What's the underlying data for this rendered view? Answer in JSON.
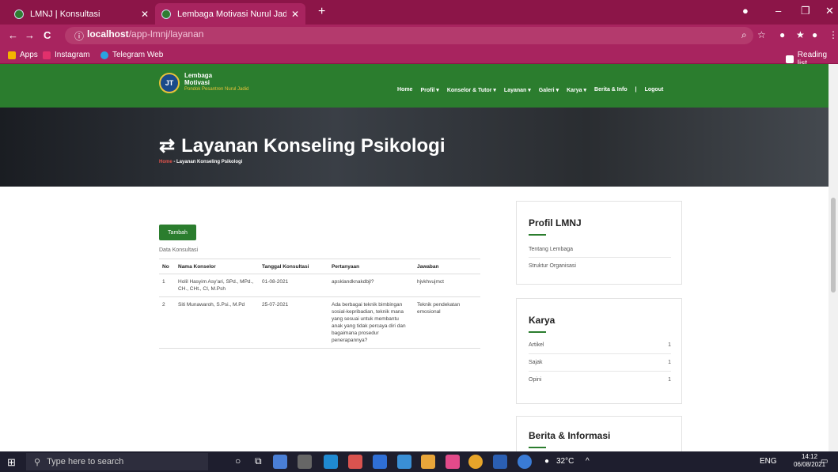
{
  "browser": {
    "tabs": [
      {
        "title": "LMNJ | Konsultasi",
        "close": "✕"
      },
      {
        "title": "Lembaga Motivasi Nurul Jadid - I",
        "close": "✕"
      }
    ],
    "new_tab": "+",
    "window_controls": {
      "minimize": "–",
      "maximize": "❐",
      "close": "✕"
    },
    "nav": {
      "back": "←",
      "forward": "→",
      "reload": "C"
    },
    "url_host": "localhost",
    "url_path": "/app-lmnj/layanan",
    "bookmarks": {
      "apps": "Apps",
      "items": [
        "Instagram",
        "Telegram Web"
      ],
      "reading_list": "Reading list"
    }
  },
  "site": {
    "logo": {
      "line1": "Lembaga",
      "line2": "Motivasi",
      "line3": "Pondok Pesantren Nurul Jadid",
      "mark": "JT"
    },
    "menu": [
      "Home",
      "Profil ▾",
      "Konselor & Tutor ▾",
      "Layanan ▾",
      "Galeri ▾",
      "Karya ▾",
      "Berita & Info",
      "|",
      "Logout"
    ],
    "hero_title": "Layanan Konseling Psikologi",
    "breadcrumb_home": "Home",
    "breadcrumb_sep": " - ",
    "breadcrumb_current": "Layanan Konseling Psikologi"
  },
  "main": {
    "add_button": "Tambah",
    "table_caption": "Data Konsultasi",
    "columns": [
      "No",
      "Nama Konselor",
      "Tanggal Konsultasi",
      "Pertanyaan",
      "Jawaban"
    ],
    "rows": [
      {
        "no": "1",
        "konselor": "Holil Hasyim Asy'ari, SPd., MPd., CH., CHt., CI, M.Psh",
        "tanggal": "01-08-2021",
        "pertanyaan": "apsklandknakdbjl?",
        "jawaban": "hjvkhvujmct"
      },
      {
        "no": "2",
        "konselor": "Siti Munawaroh, S.Psi., M.Pd",
        "tanggal": "25-07-2021",
        "pertanyaan": "Ada berbagai teknik bimbingan sosial-kepribadian, teknik mana yang sesuai untuk membantu anak yang tidak percaya diri dan bagaimana prosedur penerapannya?",
        "jawaban": "Teknik pendekatan emosional"
      }
    ]
  },
  "sidebar": {
    "profil": {
      "title": "Profil LMNJ",
      "items": [
        "Tentang Lembaga",
        "Struktur Organisasi"
      ]
    },
    "karya": {
      "title": "Karya",
      "items": [
        {
          "label": "Artikel",
          "count": "1"
        },
        {
          "label": "Sajak",
          "count": "1"
        },
        {
          "label": "Opini",
          "count": "1"
        }
      ]
    },
    "berita": {
      "title": "Berita & Informasi"
    }
  },
  "taskbar": {
    "search_placeholder": "Type here to search",
    "weather": "32°C",
    "lang": "ENG",
    "time": "14:12",
    "date": "06/08/2021"
  },
  "colors": {
    "brand_green": "#2b7d2e",
    "chrome": "#a8245f",
    "chrome_dark": "#8c1548"
  }
}
